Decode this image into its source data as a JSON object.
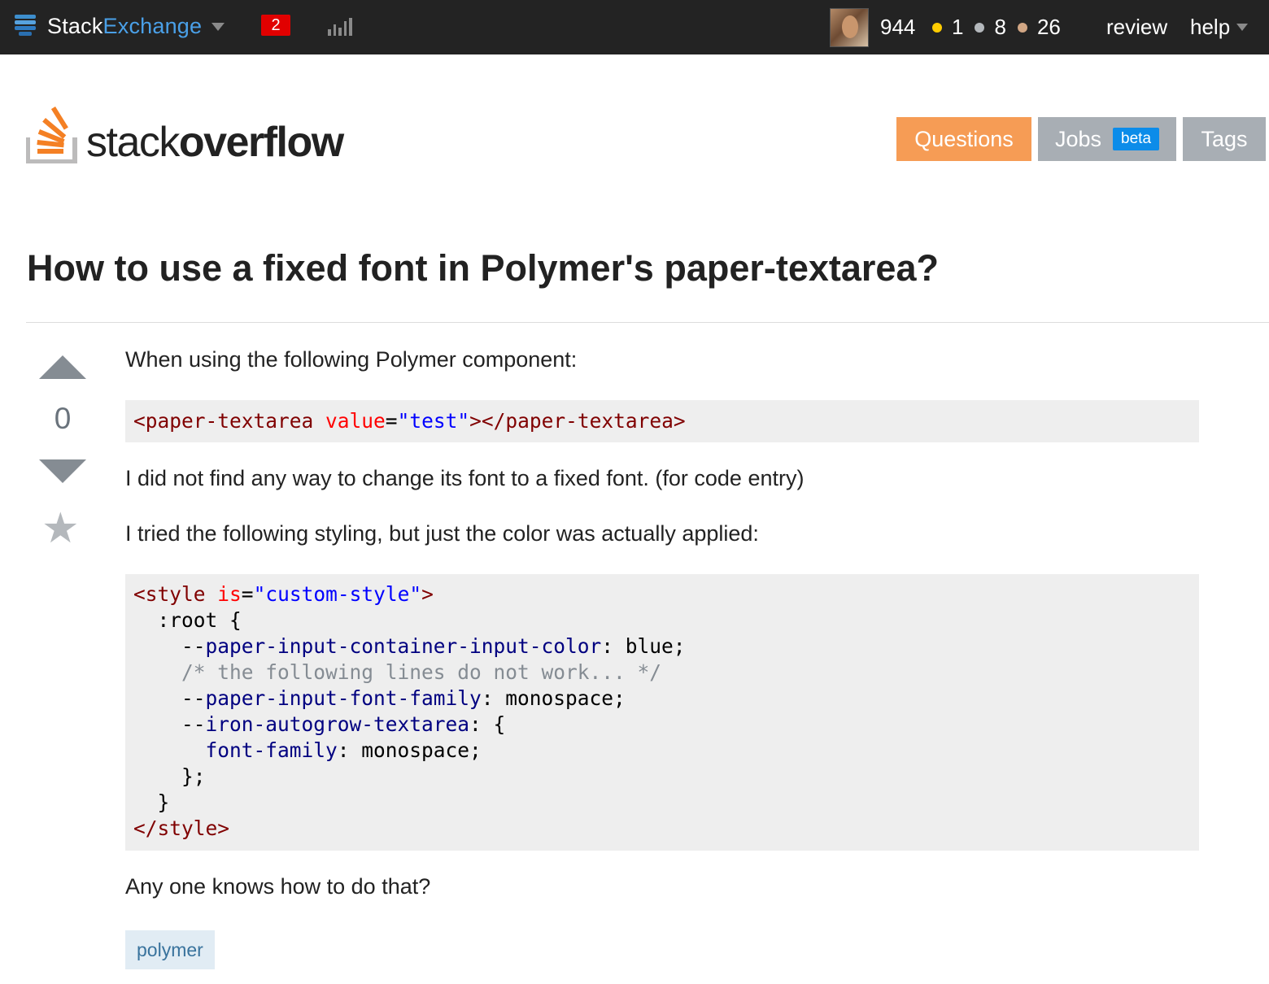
{
  "topbar": {
    "site_name_a": "Stack",
    "site_name_b": "Exchange",
    "inbox_count": "2",
    "reputation": "944",
    "badges": {
      "gold": "1",
      "silver": "8",
      "bronze": "26"
    },
    "review_label": "review",
    "help_label": "help",
    "colors": {
      "background": "#232323",
      "inbox": "#e10000",
      "gold": "#ffcc01",
      "silver": "#b4b8bc",
      "bronze": "#d1a684"
    }
  },
  "header": {
    "logo_word_light": "stack",
    "logo_word_bold": "overflow",
    "nav": {
      "questions": "Questions",
      "jobs": "Jobs",
      "jobs_badge": "beta",
      "tags": "Tags"
    },
    "colors": {
      "active": "#f69c55",
      "inactive": "#a8aeb4",
      "beta": "#0c8ce9"
    }
  },
  "question": {
    "title": "How to use a fixed font in Polymer's paper-textarea?",
    "vote_count": "0",
    "icons": [
      "upvote-arrow-icon",
      "downvote-arrow-icon",
      "favorite-star-icon"
    ],
    "para1": "When using the following Polymer component:",
    "code1": "<paper-textarea value=\"test\"></paper-textarea>",
    "para2": "I did not find any way to change its font to a fixed font. (for code entry)",
    "para3": "I tried the following styling, but just the color was actually applied:",
    "code2_lines": [
      "<style is=\"custom-style\">",
      "  :root {",
      "    --paper-input-container-input-color: blue;",
      "    /* the following lines do not work... */",
      "    --paper-input-font-family: monospace;",
      "    --iron-autogrow-textarea: {",
      "      font-family: monospace;",
      "    };",
      "  }",
      "</style>"
    ],
    "para4": "Any one knows how to do that?",
    "tags": [
      "polymer"
    ]
  }
}
